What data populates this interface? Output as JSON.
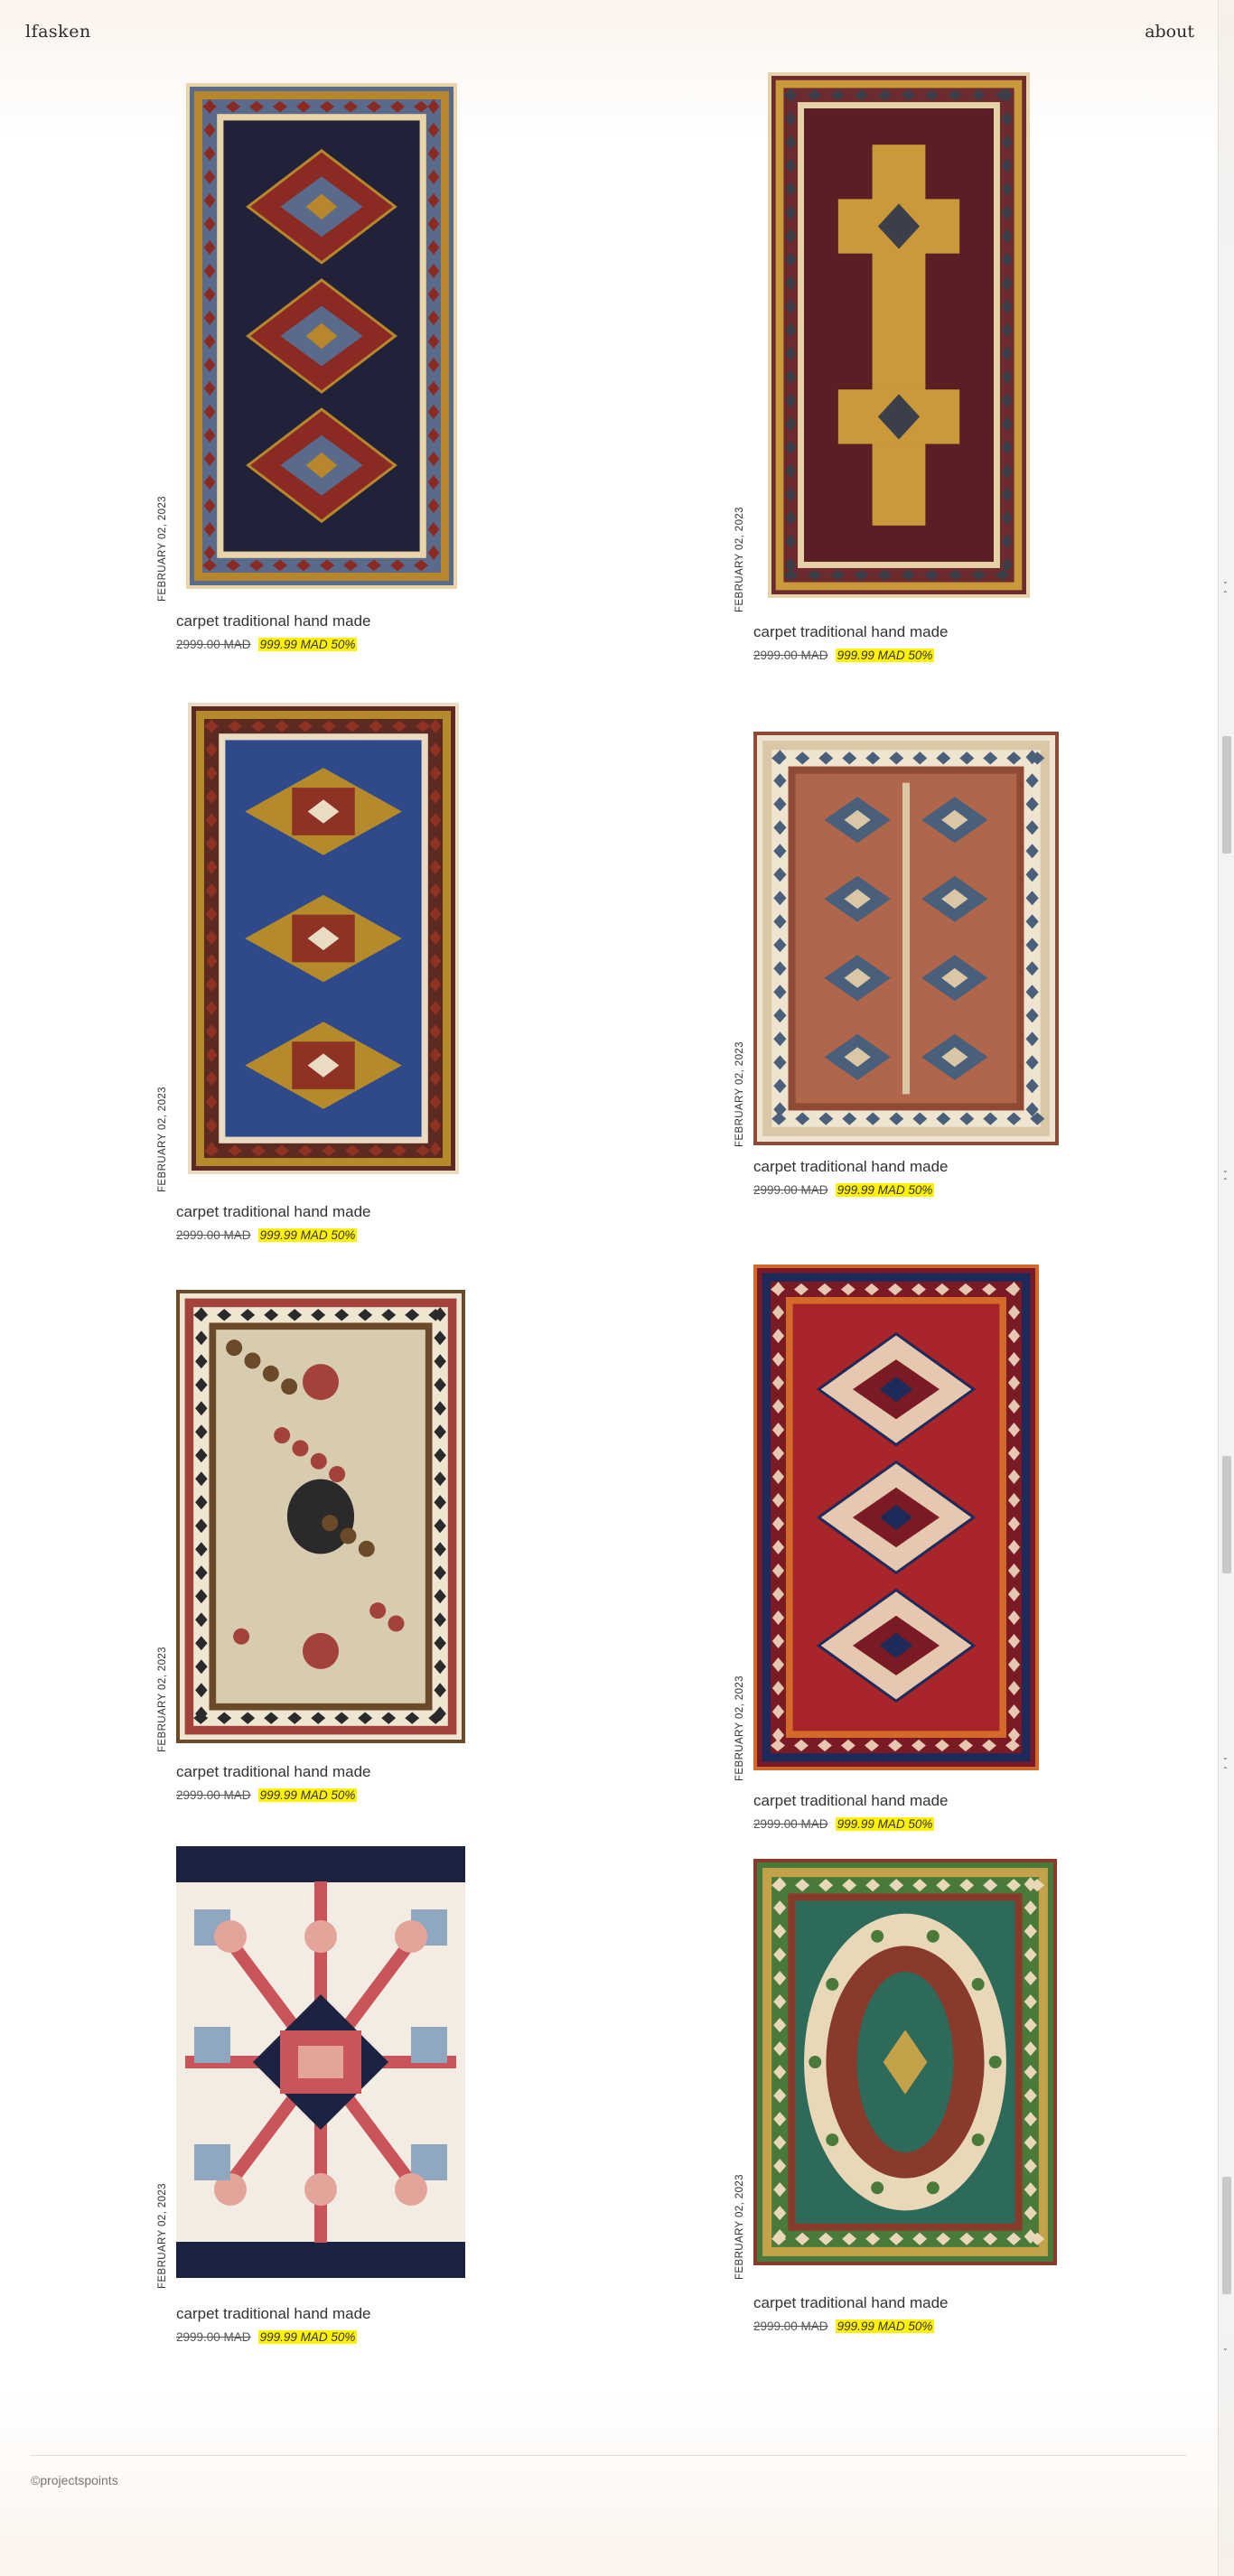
{
  "header": {
    "logo": "lfasken",
    "about_label": "about"
  },
  "products": [
    {
      "title": "carpet traditional hand made",
      "date": "FEBRUARY 02, 2023",
      "old_price": "2999.00 MAD",
      "new_price": "999.99 MAD 50%",
      "palette": [
        "#1f2238",
        "#b8862c",
        "#8a2a22",
        "#e8d6a8",
        "#5a6a8a"
      ],
      "style": "medallions"
    },
    {
      "title": "carpet traditional hand made",
      "date": "FEBRUARY 02, 2023",
      "old_price": "2999.00 MAD",
      "new_price": "999.99 MAD 50%",
      "palette": [
        "#5a1e24",
        "#c9993a",
        "#3a3f4a",
        "#e5d2a6",
        "#6e2b2f"
      ],
      "style": "cross"
    },
    {
      "title": "carpet traditional hand made",
      "date": "FEBRUARY 02, 2023",
      "old_price": "2999.00 MAD",
      "new_price": "999.99 MAD 50%",
      "palette": [
        "#2f4a8a",
        "#b58a2a",
        "#8e3324",
        "#e9dcc2",
        "#5c2a22"
      ],
      "style": "stars"
    },
    {
      "title": "carpet traditional hand made",
      "date": "FEBRUARY 02, 2023",
      "old_price": "2999.00 MAD",
      "new_price": "999.99 MAD 50%",
      "palette": [
        "#b0664a",
        "#d9c7a6",
        "#4a5f7a",
        "#8e4a34",
        "#efe4d0"
      ],
      "style": "grid"
    },
    {
      "title": "carpet traditional hand made",
      "date": "FEBRUARY 02, 2023",
      "old_price": "2999.00 MAD",
      "new_price": "999.99 MAD 50%",
      "palette": [
        "#d8ccb0",
        "#a3423a",
        "#2a2a2a",
        "#6b4a2a",
        "#efe6d2"
      ],
      "style": "field"
    },
    {
      "title": "carpet traditional hand made",
      "date": "FEBRUARY 02, 2023",
      "old_price": "2999.00 MAD",
      "new_price": "999.99 MAD 50%",
      "palette": [
        "#a8262a",
        "#1e2a5a",
        "#e6c7b0",
        "#d46a2a",
        "#7a1a24"
      ],
      "style": "medallions"
    },
    {
      "title": "carpet traditional hand made",
      "date": "FEBRUARY 02, 2023",
      "old_price": "2999.00 MAD",
      "new_price": "999.99 MAD 50%",
      "palette": [
        "#f2ece2",
        "#c9555a",
        "#1c2340",
        "#8fa8c0",
        "#e3a59a"
      ],
      "style": "closeup"
    },
    {
      "title": "carpet traditional hand made",
      "date": "FEBRUARY 02, 2023",
      "old_price": "2999.00 MAD",
      "new_price": "999.99 MAD 50%",
      "palette": [
        "#2e6a5a",
        "#c4a24a",
        "#e9d8b8",
        "#8a3a2a",
        "#4a7a3a"
      ],
      "style": "oval"
    }
  ],
  "footer": {
    "copyright": "©projectspoints"
  }
}
